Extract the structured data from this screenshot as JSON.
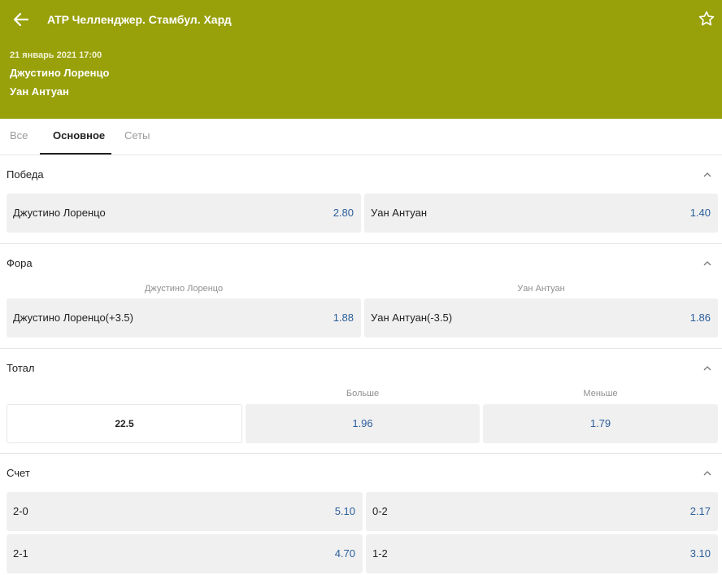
{
  "header": {
    "title": "ATP Челленджер. Стамбул. Хард",
    "date": "21 январь 2021 17:00",
    "team1": "Джустино Лоренцо",
    "team2": "Уан Антуан",
    "bg_color": "#98a00a"
  },
  "tabs": [
    {
      "label": "Все",
      "active": false
    },
    {
      "label": "Основное",
      "active": true
    },
    {
      "label": "Сеты",
      "active": false
    }
  ],
  "win": {
    "title": "Победа",
    "options": [
      {
        "label": "Джустино Лоренцо",
        "odds": "2.80"
      },
      {
        "label": "Уан Антуан",
        "odds": "1.40"
      }
    ]
  },
  "handicap": {
    "title": "Фора",
    "col1": "Джустино Лоренцо",
    "col2": "Уан Антуан",
    "options": [
      {
        "label": "Джустино Лоренцо(+3.5)",
        "odds": "1.88"
      },
      {
        "label": "Уан Антуан(-3.5)",
        "odds": "1.86"
      }
    ]
  },
  "total": {
    "title": "Тотал",
    "over_label": "Больше",
    "under_label": "Меньше",
    "line": "22.5",
    "over_odds": "1.96",
    "under_odds": "1.79"
  },
  "score": {
    "title": "Счет",
    "rows": [
      [
        {
          "label": "2-0",
          "odds": "5.10"
        },
        {
          "label": "0-2",
          "odds": "2.17"
        }
      ],
      [
        {
          "label": "2-1",
          "odds": "4.70"
        },
        {
          "label": "1-2",
          "odds": "3.10"
        }
      ]
    ]
  },
  "icons": {
    "back": "arrow-left-icon",
    "favorite": "star-outline-icon",
    "collapse": "chevron-up-icon"
  },
  "colors": {
    "odds": "#2a5e9c",
    "button_bg": "#f0f0f0"
  }
}
